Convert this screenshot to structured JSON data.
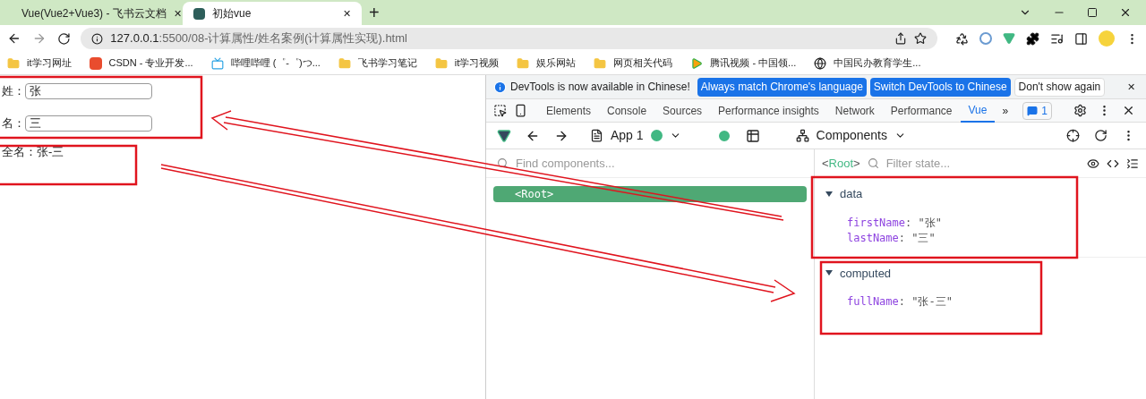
{
  "browser_tabs": [
    {
      "title": "Vue(Vue2+Vue3) - 飞书云文档",
      "selected": false,
      "close": "✕"
    },
    {
      "title": "初始vue",
      "selected": true,
      "close": "✕"
    }
  ],
  "new_tab": "+",
  "address": {
    "host": "127.0.0.1",
    "rest": ":5500/08-计算属性/姓名案例(计算属性实现).html"
  },
  "bookmarks": [
    {
      "label": "it学习网址",
      "kind": "folder"
    },
    {
      "label": "CSDN - 专业开发...",
      "kind": "csdn"
    },
    {
      "label": "哔哩哔哩 (゜-゜)つ...",
      "kind": "bili"
    },
    {
      "label": "飞书学习笔记",
      "kind": "folder"
    },
    {
      "label": "it学习视频",
      "kind": "folder"
    },
    {
      "label": "娱乐网站",
      "kind": "folder"
    },
    {
      "label": "网页相关代码",
      "kind": "folder"
    },
    {
      "label": "腾讯视频 - 中国领...",
      "kind": "video"
    },
    {
      "label": "中国民办教育学生...",
      "kind": "globe"
    }
  ],
  "page": {
    "fields": [
      {
        "label": "姓：",
        "value": "张"
      },
      {
        "label": "名：",
        "value": "三"
      }
    ],
    "full_name": "全名：张-三"
  },
  "devtools": {
    "banner": {
      "message": "DevTools is now available in Chinese!",
      "buttons": [
        {
          "label": "Always match Chrome's language",
          "kind": "primary"
        },
        {
          "label": "Switch DevTools to Chinese",
          "kind": "primary"
        },
        {
          "label": "Don't show again",
          "kind": "plain"
        }
      ],
      "close": "✕"
    },
    "tabs": [
      {
        "label": "Elements",
        "selected": false
      },
      {
        "label": "Console",
        "selected": false
      },
      {
        "label": "Sources",
        "selected": false
      },
      {
        "label": "Performance insights",
        "selected": false
      },
      {
        "label": "Network",
        "selected": false
      },
      {
        "label": "Performance",
        "selected": false
      },
      {
        "label": "Vue",
        "selected": true
      }
    ],
    "more": "»",
    "issues": "1",
    "vue_toolbar": {
      "app": "App 1",
      "view": "Components"
    },
    "find_placeholder": "Find components...",
    "tree": [
      {
        "label": "<Root>",
        "selected": true
      }
    ],
    "state_header": {
      "component": {
        "open": "<",
        "name": "Root",
        "close": ">"
      },
      "filter_placeholder": "Filter state..."
    },
    "sections": [
      {
        "title": "data",
        "expanded": true,
        "entries": [
          {
            "key": "firstName",
            "sep": ":",
            "value": "\"张\""
          },
          {
            "key": "lastName",
            "sep": ":",
            "value": "\"三\""
          }
        ]
      },
      {
        "title": "computed",
        "expanded": true,
        "entries": [
          {
            "key": "fullName",
            "sep": ":",
            "value": "\"张-三\""
          }
        ]
      }
    ]
  }
}
